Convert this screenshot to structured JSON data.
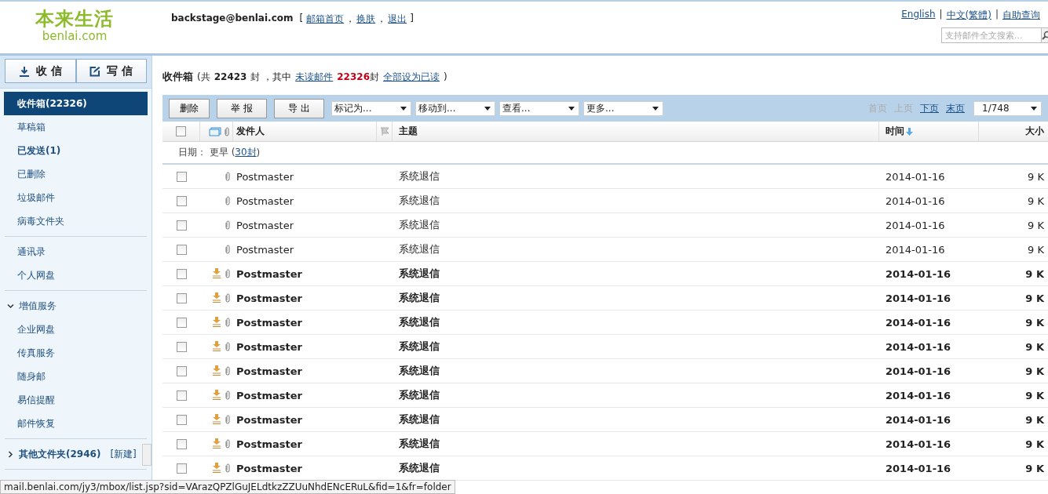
{
  "logo": {
    "title": "本来生活",
    "domain": "benlai.com"
  },
  "account": {
    "email": "backstage@benlai.com",
    "open": "[",
    "links": [
      "邮箱首页",
      "换肤",
      "退出"
    ],
    "separator": "，",
    "close": "]"
  },
  "top_links": {
    "links": [
      "English",
      "中文(繁體)",
      "自助查询"
    ],
    "separator": "|"
  },
  "search": {
    "placeholder": "支持邮件全文搜索..."
  },
  "sidebar": {
    "buttons": [
      {
        "label": "收 信",
        "kind": "receive"
      },
      {
        "label": "写 信",
        "kind": "compose"
      }
    ],
    "groups": [
      {
        "items": [
          {
            "label": "收件箱(22326)",
            "selected": true,
            "bold": true
          },
          {
            "label": "草稿箱",
            "selected": false,
            "bold": false
          },
          {
            "label": "已发送(1)",
            "selected": false,
            "bold": true
          },
          {
            "label": "已删除",
            "selected": false,
            "bold": false
          },
          {
            "label": "垃圾邮件",
            "selected": false,
            "bold": false
          },
          {
            "label": "病毒文件夹",
            "selected": false,
            "bold": false
          }
        ]
      },
      {
        "items": [
          {
            "label": "通讯录",
            "selected": false,
            "bold": false
          },
          {
            "label": "个人网盘",
            "selected": false,
            "bold": false
          }
        ]
      },
      {
        "heading": {
          "label": "增值服务",
          "expanded": true
        },
        "items": [
          {
            "label": "企业网盘",
            "selected": false,
            "bold": false
          },
          {
            "label": "传真服务",
            "selected": false,
            "bold": false
          },
          {
            "label": "随身邮",
            "selected": false,
            "bold": false
          },
          {
            "label": "易信提醒",
            "selected": false,
            "bold": false
          },
          {
            "label": "邮件恢复",
            "selected": false,
            "bold": false
          }
        ]
      },
      {
        "heading": {
          "label": "其他文件夹(2946)",
          "expanded": false,
          "action": "[新建]"
        }
      }
    ]
  },
  "summary": {
    "folder": "收件箱",
    "prefix": "(共",
    "total": "22423",
    "mid": "封 ，其中",
    "unread_link": "未读邮件",
    "unread_count": "22326",
    "unit": "封",
    "mark_all_link": "全部设为已读",
    "suffix": ")"
  },
  "toolbar": {
    "buttons": [
      "删除",
      "举 报",
      "导 出"
    ],
    "dropdowns": [
      "标记为...",
      "移动到...",
      "查看...",
      "更多..."
    ],
    "pager": [
      {
        "label": "首页",
        "disabled": true
      },
      {
        "label": "上页",
        "disabled": true
      },
      {
        "label": "下页",
        "disabled": false
      },
      {
        "label": "末页",
        "disabled": false
      }
    ],
    "page": "1/748"
  },
  "table": {
    "select_all": {
      "checked": false
    },
    "columns": {
      "sender": "发件人",
      "subject": "主题",
      "time": "时间",
      "size": "大小"
    },
    "group": {
      "label": "日期： 更早 (",
      "count_link": "30封",
      "close": ")"
    },
    "rows": [
      {
        "sender": "Postmaster",
        "subject": "系统退信",
        "time": "2014-01-16",
        "size": "9 K",
        "unread": false,
        "pop": false,
        "checked": false
      },
      {
        "sender": "Postmaster",
        "subject": "系统退信",
        "time": "2014-01-16",
        "size": "9 K",
        "unread": false,
        "pop": false,
        "checked": false
      },
      {
        "sender": "Postmaster",
        "subject": "系统退信",
        "time": "2014-01-16",
        "size": "9 K",
        "unread": false,
        "pop": false,
        "checked": false
      },
      {
        "sender": "Postmaster",
        "subject": "系统退信",
        "time": "2014-01-16",
        "size": "9 K",
        "unread": false,
        "pop": false,
        "checked": false
      },
      {
        "sender": "Postmaster",
        "subject": "系统退信",
        "time": "2014-01-16",
        "size": "9 K",
        "unread": true,
        "pop": true,
        "checked": false
      },
      {
        "sender": "Postmaster",
        "subject": "系统退信",
        "time": "2014-01-16",
        "size": "9 K",
        "unread": true,
        "pop": true,
        "checked": false
      },
      {
        "sender": "Postmaster",
        "subject": "系统退信",
        "time": "2014-01-16",
        "size": "9 K",
        "unread": true,
        "pop": true,
        "checked": false
      },
      {
        "sender": "Postmaster",
        "subject": "系统退信",
        "time": "2014-01-16",
        "size": "9 K",
        "unread": true,
        "pop": true,
        "checked": false
      },
      {
        "sender": "Postmaster",
        "subject": "系统退信",
        "time": "2014-01-16",
        "size": "9 K",
        "unread": true,
        "pop": true,
        "checked": false
      },
      {
        "sender": "Postmaster",
        "subject": "系统退信",
        "time": "2014-01-16",
        "size": "9 K",
        "unread": true,
        "pop": true,
        "checked": false
      },
      {
        "sender": "Postmaster",
        "subject": "系统退信",
        "time": "2014-01-16",
        "size": "9 K",
        "unread": true,
        "pop": true,
        "checked": false
      },
      {
        "sender": "Postmaster",
        "subject": "系统退信",
        "time": "2014-01-16",
        "size": "9 K",
        "unread": true,
        "pop": true,
        "checked": false
      },
      {
        "sender": "Postmaster",
        "subject": "系统退信",
        "time": "2014-01-16",
        "size": "9 K",
        "unread": true,
        "pop": true,
        "checked": false
      }
    ]
  },
  "status_bar": {
    "url": "mail.benlai.com/jy3/mbox/list.jsp?sid=VArazQPZlGuJELdtkzZZUuNhdENcERuL&fid=1&fr=folder"
  }
}
